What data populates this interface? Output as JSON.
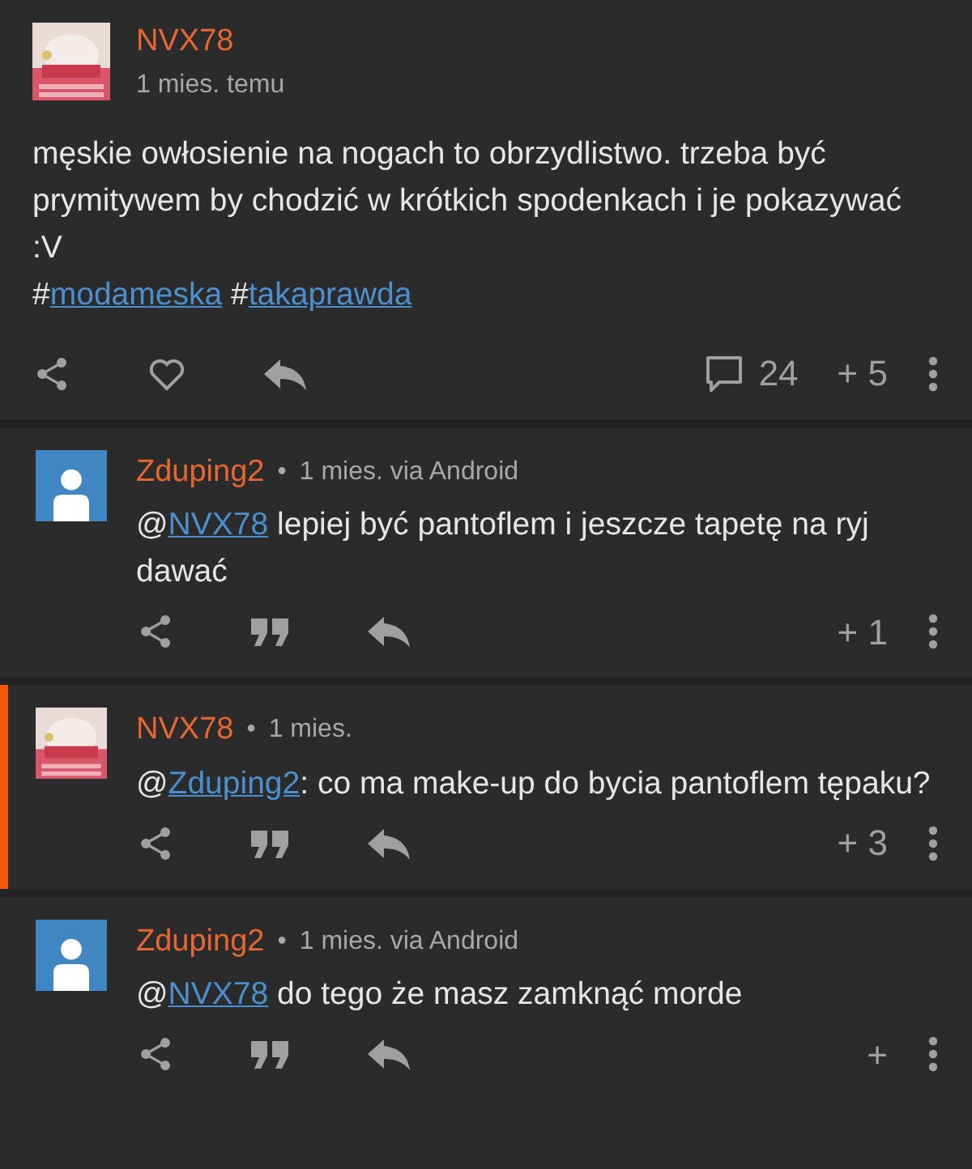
{
  "post": {
    "author": "NVX78",
    "time": "1 mies. temu",
    "text": "męskie owłosienie na nogach to obrzydlistwo. trzeba być prymitywem by chodzić w krótkich spodenkach i je pokazywać :V",
    "tags": [
      {
        "hash": "#",
        "label": "modameska"
      },
      {
        "hash": "#",
        "label": "takaprawda"
      }
    ],
    "comments": "24",
    "votes": "+ 5"
  },
  "replies": [
    {
      "author": "Zduping2",
      "bullet": "•",
      "time": "1 mies.",
      "via": "via Android",
      "avatar": {
        "kind": "default"
      },
      "highlighted": false,
      "at": "@",
      "mention": "NVX78",
      "text": " lepiej być pantoflem i jeszcze tapetę na ryj dawać",
      "votes": "+ 1"
    },
    {
      "author": "NVX78",
      "bullet": "•",
      "time": "1 mies.",
      "highlighted": true,
      "at": "@",
      "mention": "Zduping2",
      "text": ": co ma make-up do bycia pantoflem tępaku?",
      "votes": "+ 3"
    },
    {
      "author": "Zduping2",
      "bullet": "•",
      "time": "1 mies.",
      "via": "via Android",
      "avatar": {
        "kind": "default"
      },
      "highlighted": false,
      "at": "@",
      "mention": "NVX78",
      "text": " do tego że masz zamknąć morde",
      "votes": "+"
    }
  ]
}
